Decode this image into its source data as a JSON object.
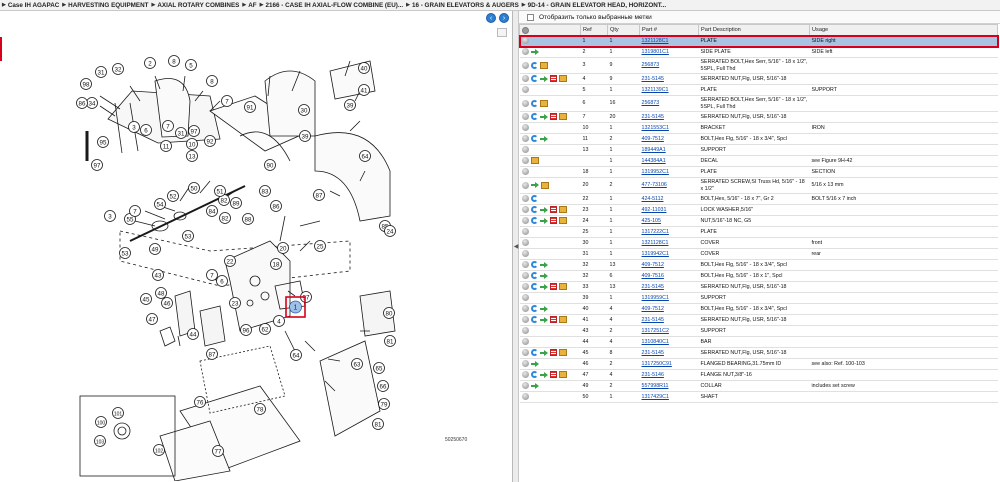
{
  "breadcrumb": [
    "Case IH AGAPAC",
    "HARVESTING EQUIPMENT",
    "AXIAL ROTARY COMBINES",
    "AF",
    "2166 - CASE IH AXIAL-FLOW COMBINE (EU)...",
    "16 - GRAIN ELEVATORS & AUGERS",
    "9D-14 - GRAIN ELEVATOR HEAD, HORIZONT..."
  ],
  "filter": {
    "label": "Отобразить только выбранные метки",
    "checked": false
  },
  "table": {
    "headers": [
      "Ref",
      "Qty",
      "Part #",
      "Part Description",
      "Usage"
    ],
    "rows": [
      {
        "icons": [
          "circle"
        ],
        "ref": "1",
        "qty": "1",
        "part": "1321128C1",
        "desc": "PLATE",
        "usage": "SIDE right",
        "selected": true
      },
      {
        "icons": [
          "circle",
          "arrow"
        ],
        "ref": "2",
        "qty": "1",
        "part": "1319801C1",
        "desc": "SIDE PLATE",
        "usage": "SIDE left"
      },
      {
        "icons": [
          "circle",
          "swirl",
          "box"
        ],
        "ref": "3",
        "qty": "9",
        "part": "256873",
        "desc": "SERRATED BOLT,Hex Serr, 5/16\" - 18 x 1/2\", 5SPL, Full Thd",
        "usage": "",
        "tall": true
      },
      {
        "icons": [
          "circle",
          "swirl",
          "arrow",
          "doc",
          "box"
        ],
        "ref": "4",
        "qty": "9",
        "part": "231-5145",
        "desc": "SERRATED NUT,Flg, USR, 5/16\"-18",
        "usage": ""
      },
      {
        "icons": [
          "circle"
        ],
        "ref": "5",
        "qty": "1",
        "part": "1321139C1",
        "desc": "PLATE",
        "usage": "SUPPORT"
      },
      {
        "icons": [
          "circle",
          "swirl",
          "box"
        ],
        "ref": "6",
        "qty": "16",
        "part": "256873",
        "desc": "SERRATED BOLT,Hex Serr, 5/16\" - 18 x 1/2\", 5SPL, Full Thd",
        "usage": "",
        "tall": true
      },
      {
        "icons": [
          "circle",
          "swirl",
          "arrow",
          "doc",
          "box"
        ],
        "ref": "7",
        "qty": "20",
        "part": "231-5145",
        "desc": "SERRATED NUT,Flg, USR, 5/16\"-18",
        "usage": ""
      },
      {
        "icons": [
          "circle"
        ],
        "ref": "10",
        "qty": "1",
        "part": "1321553C1",
        "desc": "BRACKET",
        "usage": "IRON"
      },
      {
        "icons": [
          "circle",
          "swirl",
          "arrow"
        ],
        "ref": "11",
        "qty": "2",
        "part": "409-7512",
        "desc": "BOLT,Hex Flg, 5/16\" - 18 x 3/4\", Spcl",
        "usage": ""
      },
      {
        "icons": [
          "circle"
        ],
        "ref": "13",
        "qty": "1",
        "part": "189449A1",
        "desc": "SUPPORT",
        "usage": ""
      },
      {
        "icons": [
          "circle",
          "box"
        ],
        "ref": "",
        "qty": "1",
        "part": "144384A1",
        "desc": "DECAL",
        "usage": "see Figure 9H-42"
      },
      {
        "icons": [
          "circle"
        ],
        "ref": "18",
        "qty": "1",
        "part": "1319952C1",
        "desc": "PLATE",
        "usage": "SECTION"
      },
      {
        "icons": [
          "circle",
          "arrow",
          "box"
        ],
        "ref": "20",
        "qty": "2",
        "part": "477-73106",
        "desc": "SERRATED SCREW,SI Truss Hd, 5/16\" - 18 x 1/2\"",
        "usage": "5/16 x 13 mm",
        "tall": true
      },
      {
        "icons": [
          "circle",
          "swirl"
        ],
        "ref": "22",
        "qty": "1",
        "part": "424-5112",
        "desc": "BOLT,Hex, 5/16\" - 18 x 7\", Gr 2",
        "usage": "BOLT 5/16 x 7 inch"
      },
      {
        "icons": [
          "circle",
          "swirl",
          "arrow",
          "doc",
          "box"
        ],
        "ref": "23",
        "qty": "1",
        "part": "492-11031",
        "desc": "LOCK WASHER,5/16\"",
        "usage": ""
      },
      {
        "icons": [
          "circle",
          "swirl",
          "arrow",
          "doc",
          "box"
        ],
        "ref": "24",
        "qty": "1",
        "part": "425-105",
        "desc": "NUT,5/16\"-18 NC, G5",
        "usage": ""
      },
      {
        "icons": [
          "circle"
        ],
        "ref": "25",
        "qty": "1",
        "part": "1317222C1",
        "desc": "PLATE",
        "usage": ""
      },
      {
        "icons": [
          "circle"
        ],
        "ref": "30",
        "qty": "1",
        "part": "1321128C1",
        "desc": "COVER",
        "usage": "front"
      },
      {
        "icons": [
          "circle"
        ],
        "ref": "31",
        "qty": "1",
        "part": "1319942C1",
        "desc": "COVER",
        "usage": "rear"
      },
      {
        "icons": [
          "circle",
          "swirl",
          "arrow"
        ],
        "ref": "32",
        "qty": "13",
        "part": "409-7512",
        "desc": "BOLT,Hex Flg, 5/16\" - 18 x 3/4\", Spcl",
        "usage": ""
      },
      {
        "icons": [
          "circle",
          "swirl",
          "arrow"
        ],
        "ref": "32",
        "qty": "6",
        "part": "409-7516",
        "desc": "BOLT,Hex Flg, 5/16\" - 18 x 1\", Spcl",
        "usage": ""
      },
      {
        "icons": [
          "circle",
          "swirl",
          "arrow",
          "doc",
          "box"
        ],
        "ref": "33",
        "qty": "13",
        "part": "231-5145",
        "desc": "SERRATED NUT,Flg, USR, 5/16\"-18",
        "usage": ""
      },
      {
        "icons": [
          "circle"
        ],
        "ref": "39",
        "qty": "1",
        "part": "1319959C1",
        "desc": "SUPPORT",
        "usage": ""
      },
      {
        "icons": [
          "circle",
          "swirl",
          "arrow"
        ],
        "ref": "40",
        "qty": "4",
        "part": "409-7512",
        "desc": "BOLT,Hex Flg, 5/16\" - 18 x 3/4\", Spcl",
        "usage": ""
      },
      {
        "icons": [
          "circle",
          "swirl",
          "arrow",
          "doc",
          "box"
        ],
        "ref": "41",
        "qty": "4",
        "part": "231-5145",
        "desc": "SERRATED NUT,Flg, USR, 5/16\"-18",
        "usage": ""
      },
      {
        "icons": [
          "circle"
        ],
        "ref": "43",
        "qty": "2",
        "part": "1317251C2",
        "desc": "SUPPORT",
        "usage": ""
      },
      {
        "icons": [
          "circle"
        ],
        "ref": "44",
        "qty": "4",
        "part": "1310840C1",
        "desc": "BAR",
        "usage": ""
      },
      {
        "icons": [
          "circle",
          "swirl",
          "arrow",
          "doc",
          "box"
        ],
        "ref": "45",
        "qty": "8",
        "part": "231-5145",
        "desc": "SERRATED NUT,Flg, USR, 5/16\"-18",
        "usage": ""
      },
      {
        "icons": [
          "circle",
          "arrow"
        ],
        "ref": "46",
        "qty": "2",
        "part": "1317250C91",
        "desc": "FLANGED BEARING,31.75mm ID",
        "usage": "see also: Ref. 100-103"
      },
      {
        "icons": [
          "circle",
          "swirl",
          "arrow",
          "doc",
          "box"
        ],
        "ref": "47",
        "qty": "4",
        "part": "231-5146",
        "desc": "FLANGE NUT,3/8\"-16",
        "usage": ""
      },
      {
        "icons": [
          "circle",
          "arrow"
        ],
        "ref": "49",
        "qty": "2",
        "part": "557998R11",
        "desc": "COLLAR",
        "usage": "includes set screw"
      },
      {
        "icons": [
          "circle"
        ],
        "ref": "50",
        "qty": "1",
        "part": "1317429C1",
        "desc": "SHAFT",
        "usage": ""
      }
    ]
  },
  "diagram": {
    "callouts": [
      {
        "label": "34"
      },
      {
        "label": "32"
      },
      {
        "label": "2"
      },
      {
        "label": "8"
      },
      {
        "label": "5"
      },
      {
        "label": "8"
      },
      {
        "label": "7"
      },
      {
        "label": "97"
      },
      {
        "label": "31"
      },
      {
        "label": "98"
      },
      {
        "label": "86"
      },
      {
        "label": "95"
      },
      {
        "label": "3"
      },
      {
        "label": "6"
      },
      {
        "label": "7"
      },
      {
        "label": "31"
      },
      {
        "label": "97"
      },
      {
        "label": "11"
      },
      {
        "label": "10"
      },
      {
        "label": "92"
      },
      {
        "label": "13"
      },
      {
        "label": "82"
      },
      {
        "label": "91"
      },
      {
        "label": "90"
      },
      {
        "label": "30"
      },
      {
        "label": "40"
      },
      {
        "label": "41"
      },
      {
        "label": "39"
      },
      {
        "label": "39"
      },
      {
        "label": "64"
      },
      {
        "label": "87"
      },
      {
        "label": "55"
      },
      {
        "label": "54"
      },
      {
        "label": "52"
      },
      {
        "label": "50"
      },
      {
        "label": "51"
      },
      {
        "label": "53"
      },
      {
        "label": "49"
      },
      {
        "label": "53"
      },
      {
        "label": "84"
      },
      {
        "label": "82"
      },
      {
        "label": "89"
      },
      {
        "label": "88"
      },
      {
        "label": "83"
      },
      {
        "label": "86"
      },
      {
        "label": "85"
      },
      {
        "label": "24"
      },
      {
        "label": "25"
      },
      {
        "label": "20"
      },
      {
        "label": "18"
      },
      {
        "label": "22"
      },
      {
        "label": "43"
      },
      {
        "label": "23"
      },
      {
        "label": "97"
      },
      {
        "label": "7"
      },
      {
        "label": "6"
      },
      {
        "label": "45"
      },
      {
        "label": "48"
      },
      {
        "label": "46"
      },
      {
        "label": "47"
      },
      {
        "label": "44"
      },
      {
        "label": "96"
      },
      {
        "label": "62"
      },
      {
        "label": "4"
      },
      {
        "label": "1"
      },
      {
        "label": "87"
      },
      {
        "label": "80"
      },
      {
        "label": "81"
      },
      {
        "label": "64"
      },
      {
        "label": "63"
      },
      {
        "label": "65"
      },
      {
        "label": "66"
      },
      {
        "label": "79"
      },
      {
        "label": "81"
      },
      {
        "label": "78"
      },
      {
        "label": "77"
      },
      {
        "label": "76"
      },
      {
        "label": "100"
      },
      {
        "label": "101"
      },
      {
        "label": "103"
      },
      {
        "label": "102"
      },
      {
        "label": "7"
      },
      {
        "label": "3"
      }
    ],
    "highlight": "1",
    "code": "50250670"
  }
}
